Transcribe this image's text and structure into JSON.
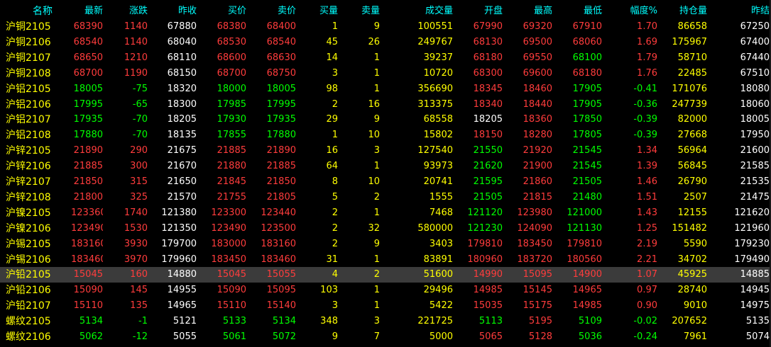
{
  "columns": [
    "名称",
    "最新",
    "涨跌",
    "昨收",
    "买价",
    "卖价",
    "买量",
    "卖量",
    "成交量",
    "开盘",
    "最高",
    "最低",
    "幅度%",
    "持仓量",
    "昨结"
  ],
  "colors": {
    "up": "#ff3c3c",
    "down": "#00ff00",
    "flat": "#ffffff",
    "volume": "#ffff00",
    "header": "#00ffff",
    "name": "#ffff00",
    "selected_row_bg": "#3b3b3b",
    "background": "#000000"
  },
  "selected_index": 16,
  "rows": [
    {
      "name": "沪铜2105",
      "last": "68390",
      "change": "1140",
      "prev_close": "67880",
      "bid": "68380",
      "ask": "68400",
      "bid_vol": "1",
      "ask_vol": "9",
      "volume": "100551",
      "open": "67990",
      "high": "69320",
      "low": "67910",
      "pct": "1.70",
      "open_interest": "86658",
      "prev_settle": "67250"
    },
    {
      "name": "沪铜2106",
      "last": "68540",
      "change": "1140",
      "prev_close": "68040",
      "bid": "68530",
      "ask": "68540",
      "bid_vol": "45",
      "ask_vol": "26",
      "volume": "249767",
      "open": "68130",
      "high": "69500",
      "low": "68060",
      "pct": "1.69",
      "open_interest": "175967",
      "prev_settle": "67400"
    },
    {
      "name": "沪铜2107",
      "last": "68650",
      "change": "1210",
      "prev_close": "68110",
      "bid": "68600",
      "ask": "68630",
      "bid_vol": "14",
      "ask_vol": "1",
      "volume": "39237",
      "open": "68180",
      "high": "69550",
      "low": "68100",
      "pct": "1.79",
      "open_interest": "58710",
      "prev_settle": "67440"
    },
    {
      "name": "沪铜2108",
      "last": "68700",
      "change": "1190",
      "prev_close": "68150",
      "bid": "68700",
      "ask": "68750",
      "bid_vol": "3",
      "ask_vol": "1",
      "volume": "10720",
      "open": "68300",
      "high": "69600",
      "low": "68180",
      "pct": "1.76",
      "open_interest": "22485",
      "prev_settle": "67510"
    },
    {
      "name": "沪铝2105",
      "last": "18005",
      "change": "-75",
      "prev_close": "18320",
      "bid": "18000",
      "ask": "18005",
      "bid_vol": "98",
      "ask_vol": "1",
      "volume": "356690",
      "open": "18345",
      "high": "18460",
      "low": "17905",
      "pct": "-0.41",
      "open_interest": "171076",
      "prev_settle": "18080"
    },
    {
      "name": "沪铝2106",
      "last": "17995",
      "change": "-65",
      "prev_close": "18300",
      "bid": "17985",
      "ask": "17995",
      "bid_vol": "2",
      "ask_vol": "16",
      "volume": "313375",
      "open": "18340",
      "high": "18440",
      "low": "17905",
      "pct": "-0.36",
      "open_interest": "247739",
      "prev_settle": "18060"
    },
    {
      "name": "沪铝2107",
      "last": "17935",
      "change": "-70",
      "prev_close": "18205",
      "bid": "17930",
      "ask": "17935",
      "bid_vol": "29",
      "ask_vol": "9",
      "volume": "68558",
      "open": "18205",
      "high": "18360",
      "low": "17850",
      "pct": "-0.39",
      "open_interest": "82000",
      "prev_settle": "18005"
    },
    {
      "name": "沪铝2108",
      "last": "17880",
      "change": "-70",
      "prev_close": "18135",
      "bid": "17855",
      "ask": "17880",
      "bid_vol": "1",
      "ask_vol": "10",
      "volume": "15802",
      "open": "18150",
      "high": "18280",
      "low": "17805",
      "pct": "-0.39",
      "open_interest": "27668",
      "prev_settle": "17950"
    },
    {
      "name": "沪锌2105",
      "last": "21890",
      "change": "290",
      "prev_close": "21675",
      "bid": "21885",
      "ask": "21890",
      "bid_vol": "16",
      "ask_vol": "3",
      "volume": "127540",
      "open": "21550",
      "high": "21920",
      "low": "21545",
      "pct": "1.34",
      "open_interest": "56964",
      "prev_settle": "21600"
    },
    {
      "name": "沪锌2106",
      "last": "21885",
      "change": "300",
      "prev_close": "21670",
      "bid": "21880",
      "ask": "21885",
      "bid_vol": "64",
      "ask_vol": "1",
      "volume": "93973",
      "open": "21620",
      "high": "21900",
      "low": "21545",
      "pct": "1.39",
      "open_interest": "56845",
      "prev_settle": "21585"
    },
    {
      "name": "沪锌2107",
      "last": "21850",
      "change": "315",
      "prev_close": "21650",
      "bid": "21845",
      "ask": "21850",
      "bid_vol": "8",
      "ask_vol": "10",
      "volume": "20741",
      "open": "21595",
      "high": "21860",
      "low": "21505",
      "pct": "1.46",
      "open_interest": "26790",
      "prev_settle": "21535"
    },
    {
      "name": "沪锌2108",
      "last": "21800",
      "change": "325",
      "prev_close": "21570",
      "bid": "21755",
      "ask": "21805",
      "bid_vol": "5",
      "ask_vol": "2",
      "volume": "1555",
      "open": "21505",
      "high": "21815",
      "low": "21480",
      "pct": "1.51",
      "open_interest": "2507",
      "prev_settle": "21475"
    },
    {
      "name": "沪镍2105",
      "last": "123360",
      "change": "1740",
      "prev_close": "121380",
      "bid": "123300",
      "ask": "123440",
      "bid_vol": "2",
      "ask_vol": "1",
      "volume": "7468",
      "open": "121120",
      "high": "123980",
      "low": "121000",
      "pct": "1.43",
      "open_interest": "12155",
      "prev_settle": "121620"
    },
    {
      "name": "沪镍2106",
      "last": "123490",
      "change": "1530",
      "prev_close": "121350",
      "bid": "123490",
      "ask": "123500",
      "bid_vol": "2",
      "ask_vol": "32",
      "volume": "580000",
      "open": "121230",
      "high": "124090",
      "low": "121130",
      "pct": "1.25",
      "open_interest": "151482",
      "prev_settle": "121960"
    },
    {
      "name": "沪锡2105",
      "last": "183160",
      "change": "3930",
      "prev_close": "179700",
      "bid": "183000",
      "ask": "183160",
      "bid_vol": "2",
      "ask_vol": "9",
      "volume": "3403",
      "open": "179810",
      "high": "183450",
      "low": "179810",
      "pct": "2.19",
      "open_interest": "5590",
      "prev_settle": "179230"
    },
    {
      "name": "沪锡2106",
      "last": "183460",
      "change": "3970",
      "prev_close": "179960",
      "bid": "183450",
      "ask": "183460",
      "bid_vol": "31",
      "ask_vol": "1",
      "volume": "83891",
      "open": "180960",
      "high": "183720",
      "low": "180560",
      "pct": "2.21",
      "open_interest": "34702",
      "prev_settle": "179490"
    },
    {
      "name": "沪铅2105",
      "last": "15045",
      "change": "160",
      "prev_close": "14880",
      "bid": "15045",
      "ask": "15055",
      "bid_vol": "4",
      "ask_vol": "2",
      "volume": "51600",
      "open": "14990",
      "high": "15095",
      "low": "14900",
      "pct": "1.07",
      "open_interest": "45925",
      "prev_settle": "14885"
    },
    {
      "name": "沪铅2106",
      "last": "15090",
      "change": "145",
      "prev_close": "14955",
      "bid": "15090",
      "ask": "15095",
      "bid_vol": "103",
      "ask_vol": "1",
      "volume": "29496",
      "open": "14985",
      "high": "15145",
      "low": "14965",
      "pct": "0.97",
      "open_interest": "28740",
      "prev_settle": "14945"
    },
    {
      "name": "沪铅2107",
      "last": "15110",
      "change": "135",
      "prev_close": "14965",
      "bid": "15110",
      "ask": "15140",
      "bid_vol": "3",
      "ask_vol": "1",
      "volume": "5422",
      "open": "15035",
      "high": "15175",
      "low": "14985",
      "pct": "0.90",
      "open_interest": "9010",
      "prev_settle": "14975"
    },
    {
      "name": "螺纹2105",
      "last": "5134",
      "change": "-1",
      "prev_close": "5121",
      "bid": "5133",
      "ask": "5134",
      "bid_vol": "348",
      "ask_vol": "3",
      "volume": "221725",
      "open": "5113",
      "high": "5195",
      "low": "5109",
      "pct": "-0.02",
      "open_interest": "207652",
      "prev_settle": "5135"
    },
    {
      "name": "螺纹2106",
      "last": "5062",
      "change": "-12",
      "prev_close": "5055",
      "bid": "5061",
      "ask": "5072",
      "bid_vol": "9",
      "ask_vol": "7",
      "volume": "5000",
      "open": "5065",
      "high": "5128",
      "low": "5036",
      "pct": "-0.24",
      "open_interest": "7961",
      "prev_settle": "5074"
    }
  ]
}
